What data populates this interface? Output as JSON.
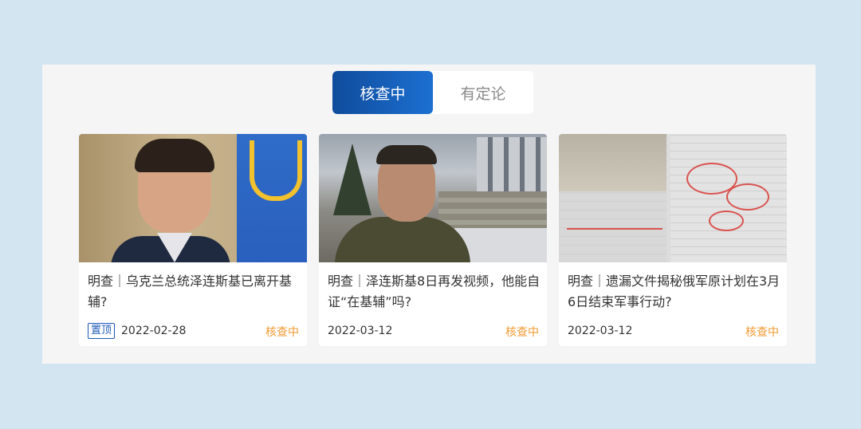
{
  "tabs": [
    {
      "label": "核查中",
      "active": true
    },
    {
      "label": "有定论",
      "active": false
    }
  ],
  "colors": {
    "accent": "#1a5fb4",
    "status": "#f39a35",
    "pin": "#1f59b8"
  },
  "cards": [
    {
      "title": "明查｜乌克兰总统泽连斯基已离开基辅?",
      "pinned": true,
      "pin_label": "置顶",
      "date": "2022-02-28",
      "status": "核查中"
    },
    {
      "title": "明查｜泽连斯基8日再发视频，他能自证“在基辅”吗?",
      "pinned": false,
      "date": "2022-03-12",
      "status": "核查中"
    },
    {
      "title": "明查｜遗漏文件揭秘俄军原计划在3月6日结束军事行动?",
      "pinned": false,
      "date": "2022-03-12",
      "status": "核查中"
    }
  ]
}
